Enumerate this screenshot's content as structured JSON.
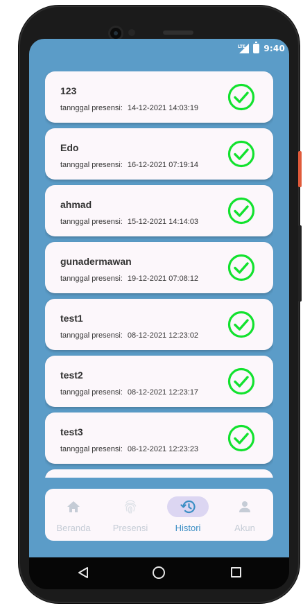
{
  "status_bar": {
    "network": "LTE",
    "time": "9:40"
  },
  "histories": [
    {
      "name": "123",
      "label": "tannggal presensi:",
      "datetime": "14-12-2021 14:03:19"
    },
    {
      "name": "Edo",
      "label": "tannggal presensi:",
      "datetime": "16-12-2021 07:19:14"
    },
    {
      "name": "ahmad",
      "label": "tannggal presensi:",
      "datetime": "15-12-2021 14:14:03"
    },
    {
      "name": "gunadermawan",
      "label": "tannggal presensi:",
      "datetime": "19-12-2021 07:08:12"
    },
    {
      "name": "test1",
      "label": "tannggal presensi:",
      "datetime": "08-12-2021 12:23:02"
    },
    {
      "name": "test2",
      "label": "tannggal presensi:",
      "datetime": "08-12-2021 12:23:17"
    },
    {
      "name": "test3",
      "label": "tannggal presensi:",
      "datetime": "08-12-2021 12:23:23"
    }
  ],
  "bottom_nav": {
    "items": [
      {
        "label": "Beranda",
        "icon": "home-icon",
        "active": false
      },
      {
        "label": "Presensi",
        "icon": "fingerprint-icon",
        "active": false
      },
      {
        "label": "Histori",
        "icon": "history-icon",
        "active": true
      },
      {
        "label": "Akun",
        "icon": "person-icon",
        "active": false
      }
    ]
  },
  "colors": {
    "background": "#5b9cc8",
    "card": "#fcf7fb",
    "check": "#12e22e",
    "nav_active_text": "#3b8ec4",
    "nav_active_pill": "#dcd6f2",
    "nav_inactive": "#c5ccd6"
  }
}
